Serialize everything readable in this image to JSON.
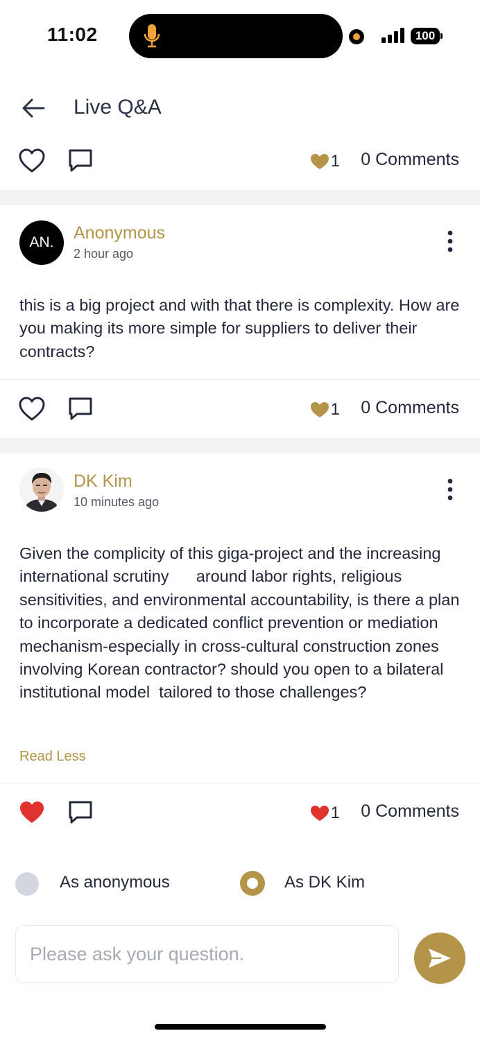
{
  "status_bar": {
    "time": "11:02",
    "battery": "100"
  },
  "header": {
    "title": "Live Q&A"
  },
  "top_actions": {
    "likes": "1",
    "comments": "0 Comments"
  },
  "posts": [
    {
      "avatar_initials": "AN.",
      "author": "Anonymous",
      "time": "2 hour ago",
      "text": "this is a big project and with that there is complexity. How are you making its more simple for suppliers to deliver their contracts?",
      "likes": "1",
      "comments": "0 Comments",
      "liked_by_me": false
    },
    {
      "author": "DK Kim",
      "time": "10 minutes ago",
      "text": "Given the complicity of this giga-project and the increasing international scrutiny      around labor rights, religious sensitivities, and environmental accountability, is there a plan to incorporate a dedicated conflict prevention or mediation mechanism-especially in cross-cultural construction zones involving Korean contractor? should you open to a bilateral institutional model  tailored to those challenges?",
      "read_less": "Read Less",
      "likes": "1",
      "comments": "0 Comments",
      "liked_by_me": true
    }
  ],
  "identity": {
    "anonymous_label": "As anonymous",
    "named_label": "As DK Kim",
    "selected": "named"
  },
  "composer": {
    "placeholder": "Please ask your question."
  },
  "colors": {
    "accent": "#b39448",
    "heart_red": "#e0332e",
    "text": "#23283a"
  }
}
